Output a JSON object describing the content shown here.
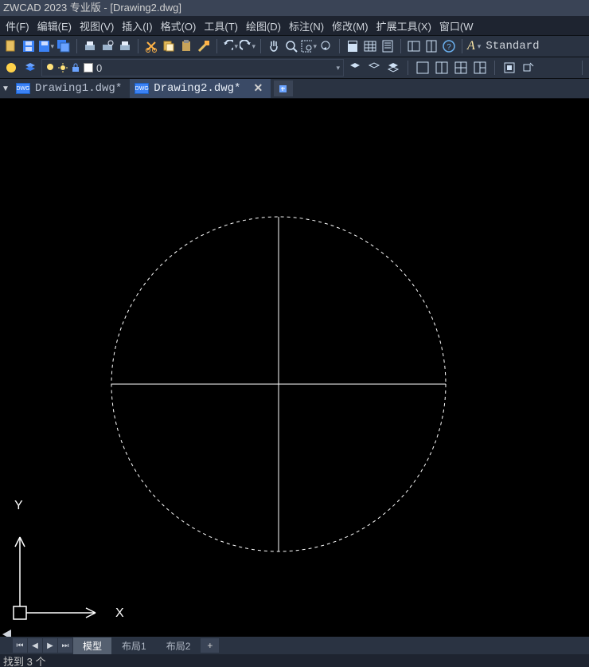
{
  "title": "ZWCAD 2023 专业版 - [Drawing2.dwg]",
  "menus": [
    {
      "label": "件(F)"
    },
    {
      "label": "编辑(E)"
    },
    {
      "label": "视图(V)"
    },
    {
      "label": "插入(I)"
    },
    {
      "label": "格式(O)"
    },
    {
      "label": "工具(T)"
    },
    {
      "label": "绘图(D)"
    },
    {
      "label": "标注(N)"
    },
    {
      "label": "修改(M)"
    },
    {
      "label": "扩展工具(X)"
    },
    {
      "label": "窗口(W"
    }
  ],
  "layer": {
    "name": "0"
  },
  "style_box": "Standard",
  "file_tabs": [
    {
      "name": "Drawing1.dwg*",
      "active": false
    },
    {
      "name": "Drawing2.dwg*",
      "active": true
    }
  ],
  "bottom_tabs": {
    "model": "模型",
    "layout1": "布局1",
    "layout2": "布局2"
  },
  "axis": {
    "x": "X",
    "y": "Y"
  },
  "status": "找到 3 个"
}
